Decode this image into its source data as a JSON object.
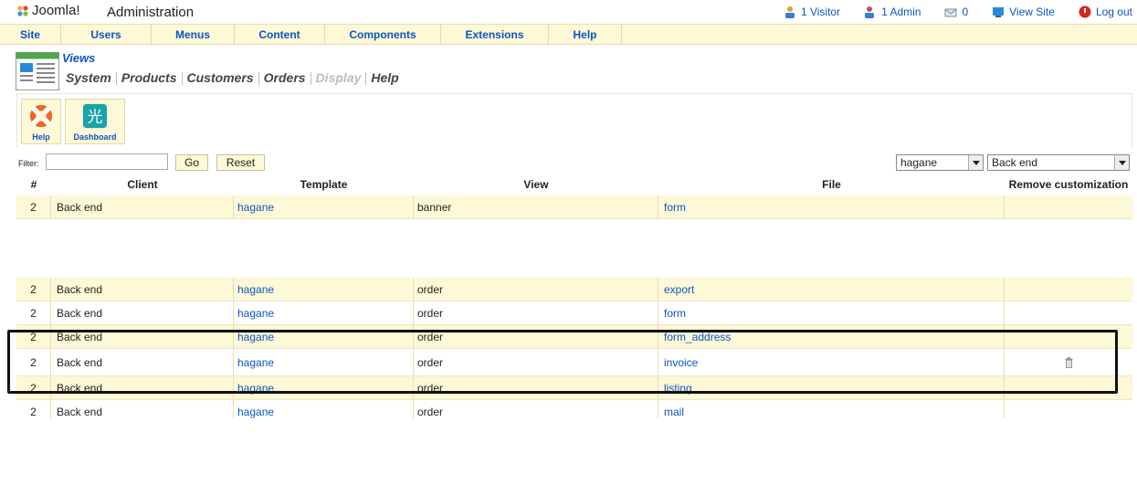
{
  "header": {
    "logo_text": "Joomla!",
    "title": "Administration",
    "links": [
      {
        "name": "visitors",
        "label": "1 Visitor"
      },
      {
        "name": "admins",
        "label": "1 Admin"
      },
      {
        "name": "messages",
        "label": "0"
      },
      {
        "name": "view-site",
        "label": "View Site"
      },
      {
        "name": "logout",
        "label": "Log out"
      }
    ]
  },
  "menu": [
    "Site",
    "Users",
    "Menus",
    "Content",
    "Components",
    "Extensions",
    "Help"
  ],
  "views": {
    "title": "Views",
    "submenu": [
      {
        "label": "System",
        "disabled": false
      },
      {
        "label": "Products",
        "disabled": false
      },
      {
        "label": "Customers",
        "disabled": false
      },
      {
        "label": "Orders",
        "disabled": false
      },
      {
        "label": "Display",
        "disabled": true
      },
      {
        "label": "Help",
        "disabled": false
      }
    ]
  },
  "toolbar": {
    "help_label": "Help",
    "dashboard_label": "Dashboard"
  },
  "filter": {
    "label": "Filter:",
    "value": "",
    "go_label": "Go",
    "reset_label": "Reset",
    "template_select": "hagane",
    "client_select": "Back end"
  },
  "table": {
    "headers": {
      "num": "#",
      "client": "Client",
      "template": "Template",
      "view": "View",
      "file": "File",
      "remove": "Remove customization"
    },
    "rows": [
      {
        "num": "2",
        "client": "Back end",
        "template": "hagane",
        "view": "banner",
        "file": "form",
        "removable": false
      },
      {
        "num": "2",
        "client": "Back end",
        "template": "hagane",
        "view": "order",
        "file": "export",
        "removable": false
      },
      {
        "num": "2",
        "client": "Back end",
        "template": "hagane",
        "view": "order",
        "file": "form",
        "removable": false
      },
      {
        "num": "2",
        "client": "Back end",
        "template": "hagane",
        "view": "order",
        "file": "form_address",
        "removable": false
      },
      {
        "num": "2",
        "client": "Back end",
        "template": "hagane",
        "view": "order",
        "file": "invoice",
        "removable": true
      },
      {
        "num": "2",
        "client": "Back end",
        "template": "hagane",
        "view": "order",
        "file": "listing",
        "removable": false
      },
      {
        "num": "2",
        "client": "Back end",
        "template": "hagane",
        "view": "order",
        "file": "mail",
        "removable": false
      }
    ]
  },
  "colors": {
    "link": "#0b55c4",
    "band": "#fdf8d6",
    "highlight_border": "#111111"
  }
}
